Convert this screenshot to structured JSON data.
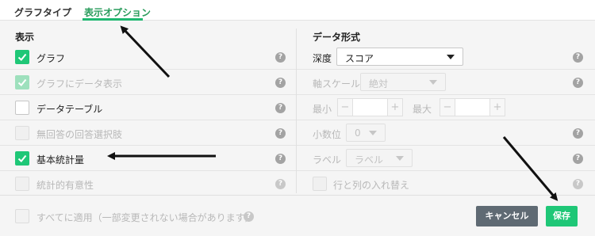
{
  "tabs": [
    {
      "label": "グラフタイプ",
      "active": false
    },
    {
      "label": "表示オプション",
      "active": true
    }
  ],
  "left": {
    "title": "表示",
    "items": [
      {
        "label": "グラフ",
        "checked": true,
        "enabled": true
      },
      {
        "label": "グラフにデータ表示",
        "checked": true,
        "enabled": false
      },
      {
        "label": "データテーブル",
        "checked": false,
        "enabled": true
      },
      {
        "label": "無回答の回答選択肢",
        "checked": false,
        "enabled": false
      },
      {
        "label": "基本統計量",
        "checked": true,
        "enabled": true
      },
      {
        "label": "統計的有意性",
        "checked": false,
        "enabled": false
      }
    ]
  },
  "right": {
    "title": "データ形式",
    "depth": {
      "label": "深度",
      "value": "スコア"
    },
    "axis_scale": {
      "label": "軸スケール",
      "value": "絶対"
    },
    "min_label": "最小",
    "max_label": "最大",
    "decimals": {
      "label": "小数位",
      "value": "0"
    },
    "chart_label": {
      "label": "ラベル",
      "value": "ラベル"
    },
    "swap": {
      "label": "行と列の入れ替え"
    }
  },
  "footer": {
    "apply_all": "すべてに適用（一部変更されない場合があります）",
    "cancel": "キャンセル",
    "save": "保存"
  },
  "help_glyph": "?",
  "colors": {
    "accent": "#1fc777",
    "cancel": "#5f6a73"
  }
}
